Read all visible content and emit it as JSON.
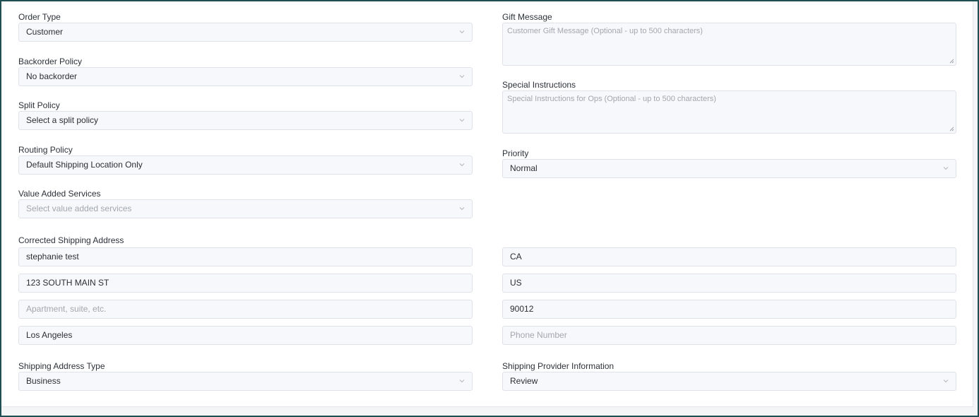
{
  "left": {
    "order_type": {
      "label": "Order Type",
      "value": "Customer"
    },
    "backorder_policy": {
      "label": "Backorder Policy",
      "value": "No backorder"
    },
    "split_policy": {
      "label": "Split Policy",
      "value": "Select a split policy"
    },
    "routing_policy": {
      "label": "Routing Policy",
      "value": "Default Shipping Location Only"
    },
    "value_added_services": {
      "label": "Value Added Services",
      "placeholder": "Select value added services"
    }
  },
  "right": {
    "gift_message": {
      "label": "Gift Message",
      "placeholder": "Customer Gift Message (Optional - up to 500 characters)"
    },
    "special_instructions": {
      "label": "Special Instructions",
      "placeholder": "Special Instructions for Ops (Optional - up to 500 characters)"
    },
    "priority": {
      "label": "Priority",
      "value": "Normal"
    }
  },
  "address": {
    "label": "Corrected Shipping Address",
    "name": "stephanie test",
    "street": "123 SOUTH MAIN ST",
    "apartment_placeholder": "Apartment, suite, etc.",
    "city": "Los Angeles",
    "state": "CA",
    "country": "US",
    "zip": "90012",
    "phone_placeholder": "Phone Number"
  },
  "shipping_address_type": {
    "label": "Shipping Address Type",
    "value": "Business"
  },
  "shipping_provider": {
    "label": "Shipping Provider Information",
    "value": "Review"
  },
  "icons": {
    "dropdown": "chevron-down-icon",
    "resize": "resize-grip-icon"
  },
  "colors": {
    "frame": "#1f4f52",
    "field_bg": "#f7f8fb",
    "field_border": "#dfe2e8",
    "placeholder": "#a2a7af"
  }
}
